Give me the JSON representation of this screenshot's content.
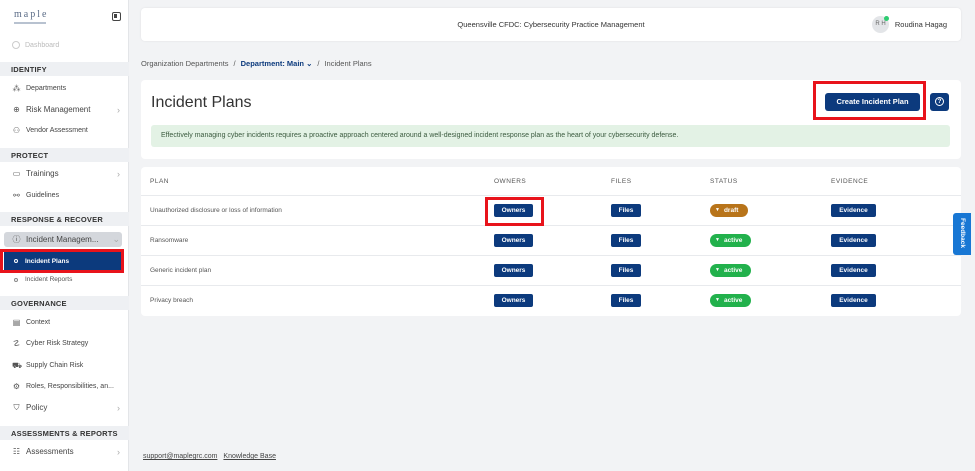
{
  "app": {
    "logo": "maple",
    "header_title": "Queensville CFDC: Cybersecurity Practice Management",
    "user_initials": "R H",
    "user_name": "Roudina Hagag"
  },
  "sidebar": {
    "dashboard": "Dashboard",
    "sections": [
      {
        "title": "IDENTIFY"
      },
      {
        "title": "PROTECT"
      },
      {
        "title": "RESPONSE & RECOVER"
      },
      {
        "title": "GOVERNANCE"
      },
      {
        "title": "ASSESSMENTS & REPORTS"
      }
    ],
    "items": {
      "departments": "Departments",
      "risk_management": "Risk Management",
      "vendor_assessment": "Vendor Assessment",
      "trainings": "Trainings",
      "guidelines": "Guidelines",
      "incident_management": "Incident Managem...",
      "incident_plans": "Incident Plans",
      "incident_reports": "Incident Reports",
      "context": "Context",
      "cyber_risk_strategy": "Cyber Risk Strategy",
      "supply_chain_risk": "Supply Chain Risk",
      "roles": "Roles, Responsibilities, an...",
      "policy": "Policy",
      "assessments": "Assessments"
    }
  },
  "breadcrumb": {
    "org": "Organization Departments",
    "sep": "/",
    "department": "Department: Main",
    "current": "Incident Plans"
  },
  "page": {
    "title": "Incident Plans",
    "create_button": "Create Incident Plan",
    "help": "?",
    "info": "Effectively managing cyber incidents requires a proactive approach centered around a well-designed incident response plan as the heart of your cybersecurity defense."
  },
  "table": {
    "headers": {
      "plan": "PLAN",
      "owners": "OWNERS",
      "files": "FILES",
      "status": "STATUS",
      "evidence": "EVIDENCE"
    },
    "rows": [
      {
        "plan": "Unauthorized disclosure or loss of information",
        "owners": "Owners",
        "files": "Files",
        "status": "draft",
        "evidence": "Evidence"
      },
      {
        "plan": "Ransomware",
        "owners": "Owners",
        "files": "Files",
        "status": "active",
        "evidence": "Evidence"
      },
      {
        "plan": "Generic incident plan",
        "owners": "Owners",
        "files": "Files",
        "status": "active",
        "evidence": "Evidence"
      },
      {
        "plan": "Privacy breach",
        "owners": "Owners",
        "files": "Files",
        "status": "active",
        "evidence": "Evidence"
      }
    ]
  },
  "footer": {
    "email": "support@maplegrc.com",
    "kb": "Knowledge Base"
  },
  "feedback": "Feedback",
  "colors": {
    "primary": "#0c3a7d",
    "draft": "#b8741a",
    "active": "#22b14c",
    "highlight": "#e8131b",
    "banner": "#e3f2e5"
  }
}
